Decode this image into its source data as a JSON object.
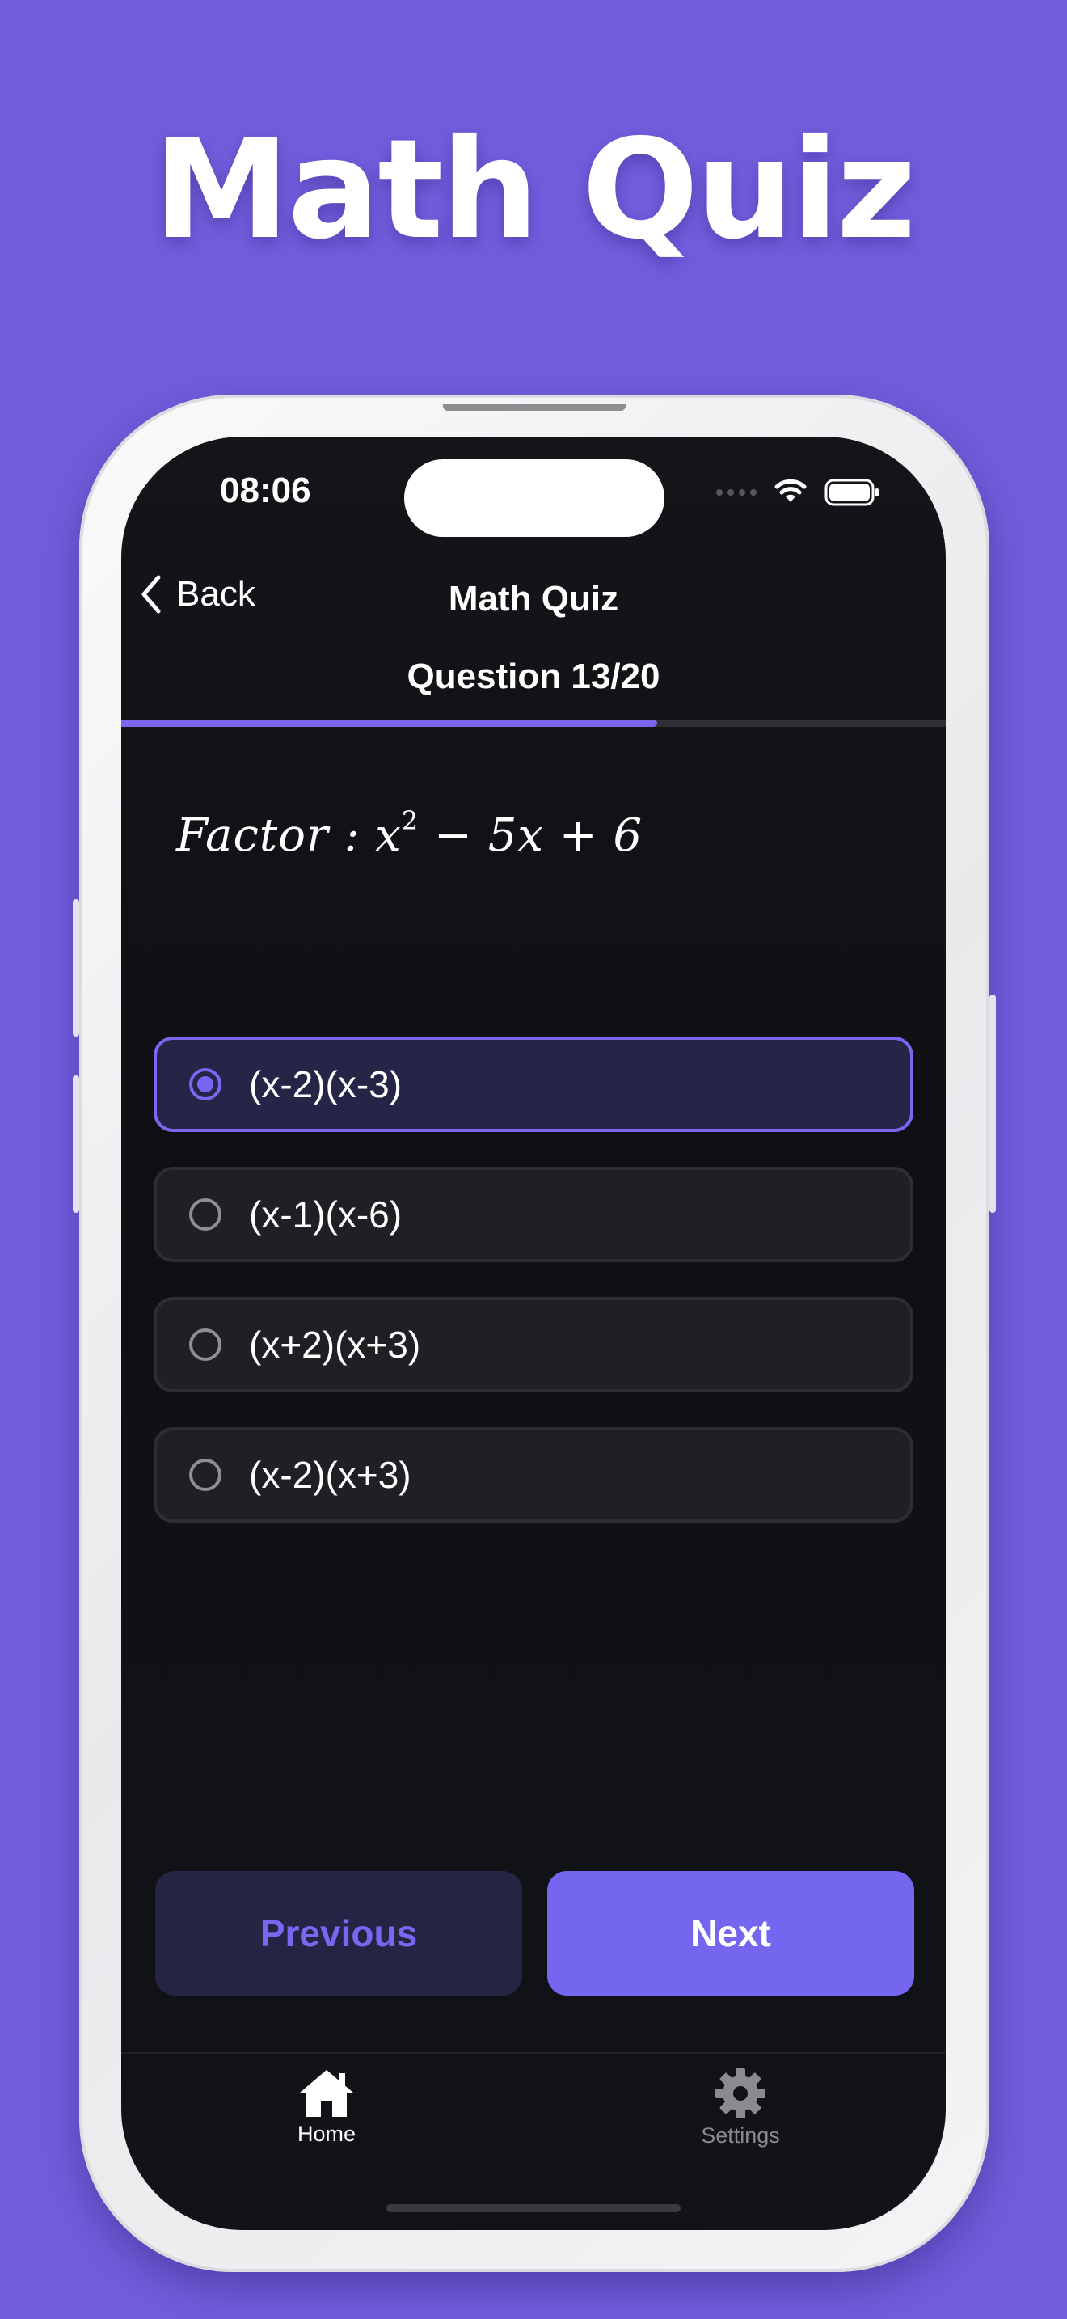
{
  "headline": "Math Quiz",
  "status_bar": {
    "time": "08:06"
  },
  "nav": {
    "back_label": "Back",
    "title": "Math Quiz"
  },
  "quiz": {
    "question_label": "Question 13/20",
    "progress": 0.65,
    "question": {
      "prefix": "Factor : x",
      "exponent": "2",
      "suffix": " − 5x + 6"
    },
    "options": [
      {
        "label": "(x-2)(x-3)",
        "selected": true
      },
      {
        "label": "(x-1)(x-6)",
        "selected": false
      },
      {
        "label": "(x+2)(x+3)",
        "selected": false
      },
      {
        "label": "(x-2)(x+3)",
        "selected": false
      }
    ]
  },
  "buttons": {
    "previous": "Previous",
    "next": "Next"
  },
  "tabs": [
    {
      "label": "Home",
      "icon": "home-icon",
      "active": true
    },
    {
      "label": "Settings",
      "icon": "gear-icon",
      "active": false
    }
  ],
  "colors": {
    "background": "#735ddd",
    "accent": "#7a66f0",
    "screen": "#0e1014"
  }
}
